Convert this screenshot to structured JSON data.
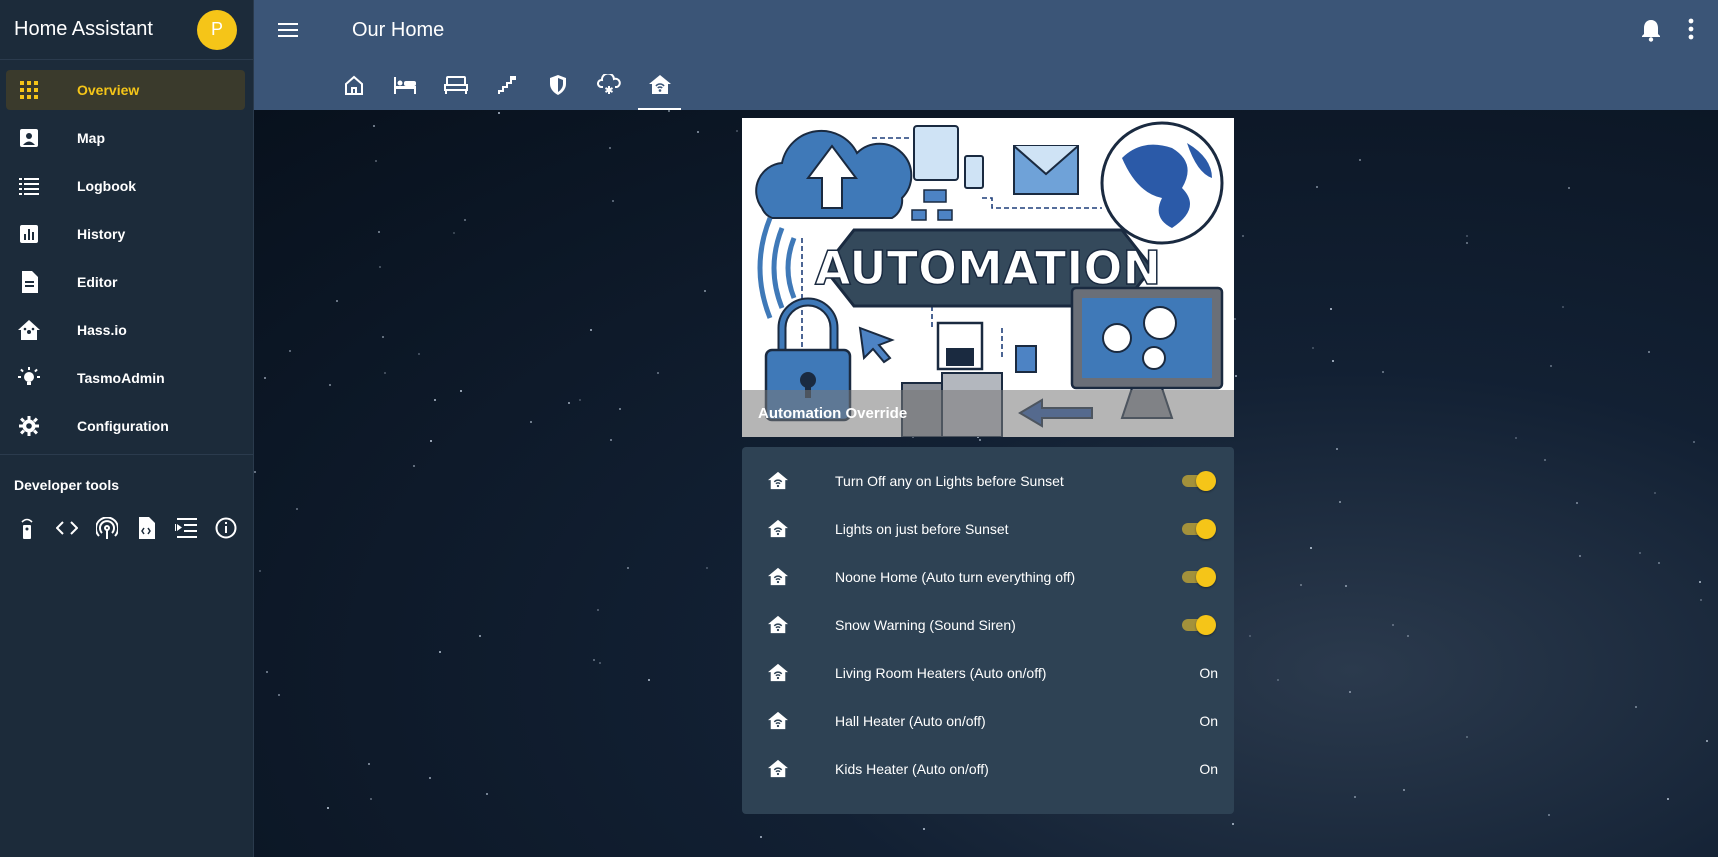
{
  "app": {
    "title": "Home Assistant",
    "avatar_initial": "P"
  },
  "sidebar": {
    "items": [
      {
        "label": "Overview",
        "icon": "grid-icon",
        "active": true
      },
      {
        "label": "Map",
        "icon": "account-box-icon"
      },
      {
        "label": "Logbook",
        "icon": "list-icon"
      },
      {
        "label": "History",
        "icon": "chart-icon"
      },
      {
        "label": "Editor",
        "icon": "file-icon"
      },
      {
        "label": "Hass.io",
        "icon": "home-assistant-icon"
      },
      {
        "label": "TasmoAdmin",
        "icon": "lightbulb-icon"
      },
      {
        "label": "Configuration",
        "icon": "gear-icon"
      }
    ],
    "dev_title": "Developer tools",
    "dev_tools": [
      "remote-icon",
      "code-icon",
      "antenna-icon",
      "file-code-icon",
      "format-indent-icon",
      "info-icon"
    ]
  },
  "header": {
    "title": "Our Home"
  },
  "tabs": [
    "home-icon",
    "bed-icon",
    "bed-double-icon",
    "stairs-icon",
    "shield-icon",
    "weather-snowy-icon",
    "home-automation-icon"
  ],
  "card": {
    "picture_title": "Automation Override",
    "picture_text": "AUTOMATION",
    "entities": [
      {
        "name": "Turn Off any on Lights before Sunset",
        "toggle": true
      },
      {
        "name": "Lights on just before Sunset",
        "toggle": true
      },
      {
        "name": "Noone Home (Auto turn everything off)",
        "toggle": true
      },
      {
        "name": "Snow Warning (Sound Siren)",
        "toggle": true
      },
      {
        "name": "Living Room Heaters (Auto on/off)",
        "state": "On"
      },
      {
        "name": "Hall Heater (Auto on/off)",
        "state": "On"
      },
      {
        "name": "Kids Heater (Auto on/off)",
        "state": "On"
      }
    ]
  },
  "colors": {
    "accent": "#f5c518",
    "header": "#3b5577",
    "sidebar": "#1c2b3a",
    "card": "#2e4254"
  }
}
